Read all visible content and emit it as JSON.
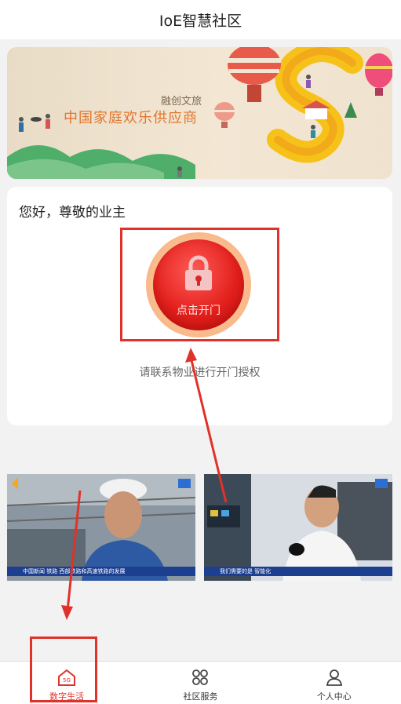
{
  "header": {
    "title": "IoE智慧社区"
  },
  "banner": {
    "brand": "融创文旅",
    "slogan": "中国家庭欢乐供应商"
  },
  "access_card": {
    "greeting": "您好，尊敬的业主",
    "door_button_label": "点击开门",
    "hint": "请联系物业进行开门授权"
  },
  "videos": [
    {
      "caption": "中国新闻 铁路 西部铁路和高速铁路的发展"
    },
    {
      "caption": "我们需要的是 智能化"
    }
  ],
  "tabbar": {
    "items": [
      {
        "label": "数字生活",
        "icon": "home-5g-icon",
        "active": true
      },
      {
        "label": "社区服务",
        "icon": "grid-icon",
        "active": false
      },
      {
        "label": "个人中心",
        "icon": "person-icon",
        "active": false
      }
    ]
  },
  "colors": {
    "accent": "#e0322a",
    "door_button": "#e3201c",
    "slogan": "#e2762f"
  }
}
